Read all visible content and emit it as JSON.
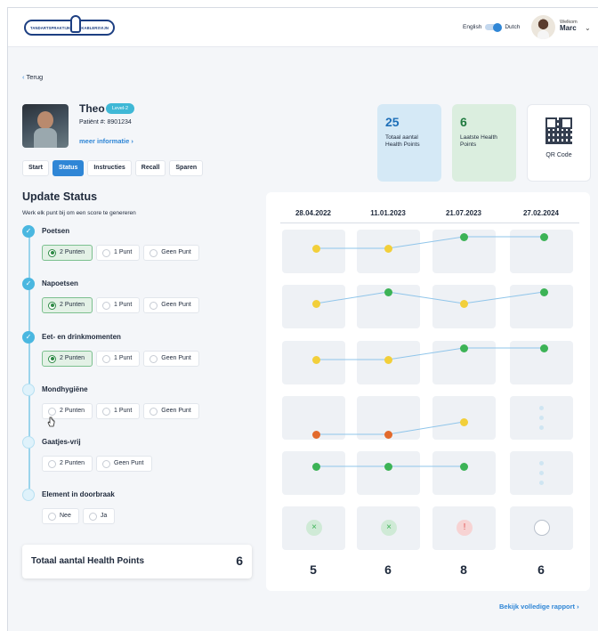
{
  "header": {
    "logo_left": "TANDARTSPRAKTIJK",
    "logo_right": "KABLERSVIJN",
    "lang_english": "English",
    "lang_dutch": "Dutch",
    "welcome": "Welkom",
    "user": "Marc"
  },
  "nav": {
    "back": "Terug"
  },
  "patient": {
    "name": "Theo",
    "level": "Level-2",
    "number": "Patiënt #: 8901234",
    "more": "meer informatie"
  },
  "tabs": [
    "Start",
    "Status",
    "Instructies",
    "Recall",
    "Sparen"
  ],
  "active_tab": "Status",
  "cards": {
    "total_num": "25",
    "total_label": "Totaal aantal Health Points",
    "last_num": "6",
    "last_label": "Laatste Health Points",
    "qr_label": "QR Code"
  },
  "update": {
    "title": "Update Status",
    "subtitle": "Werk elk punt bij om een score te genereren",
    "steps": [
      {
        "label": "Poetsen",
        "done": true,
        "options": [
          "2 Punten",
          "1 Punt",
          "Geen Punt"
        ],
        "selected": 0
      },
      {
        "label": "Napoetsen",
        "done": true,
        "options": [
          "2 Punten",
          "1 Punt",
          "Geen Punt"
        ],
        "selected": 0
      },
      {
        "label": "Eet- en drinkmomenten",
        "done": true,
        "options": [
          "2 Punten",
          "1 Punt",
          "Geen Punt"
        ],
        "selected": 0
      },
      {
        "label": "Mondhygiëne",
        "done": false,
        "options": [
          "2 Punten",
          "1 Punt",
          "Geen Punt"
        ],
        "selected": -1
      },
      {
        "label": "Gaatjes-vrij",
        "done": false,
        "options": [
          "2 Punten",
          "Geen Punt"
        ],
        "selected": -1
      },
      {
        "label": "Element in doorbraak",
        "done": false,
        "options": [
          "Nee",
          "Ja"
        ],
        "selected": -1
      }
    ]
  },
  "total": {
    "label": "Totaal aantal Health Points",
    "value": "6"
  },
  "history": {
    "dates": [
      "28.04.2022",
      "11.01.2023",
      "21.07.2023",
      "27.02.2024"
    ],
    "colors": {
      "good": "#3cb356",
      "medium": "#f2cf3a",
      "bad": "#e26a2c",
      "line": "#8fc5ea"
    },
    "rows": [
      {
        "levels": [
          "medium",
          "medium",
          "good",
          "good"
        ]
      },
      {
        "levels": [
          "medium",
          "good",
          "medium",
          "good"
        ]
      },
      {
        "levels": [
          "medium",
          "medium",
          "good",
          "good"
        ]
      },
      {
        "levels": [
          "bad",
          "bad",
          "medium",
          null
        ]
      },
      {
        "levels": [
          "good",
          "good",
          "good",
          null
        ]
      }
    ],
    "status_icons": [
      "x-icon",
      "x-icon",
      "exclamation-icon",
      "empty-circle-icon"
    ],
    "totals": [
      "5",
      "6",
      "8",
      "6"
    ]
  },
  "report_link": "Bekijk volledige rapport"
}
